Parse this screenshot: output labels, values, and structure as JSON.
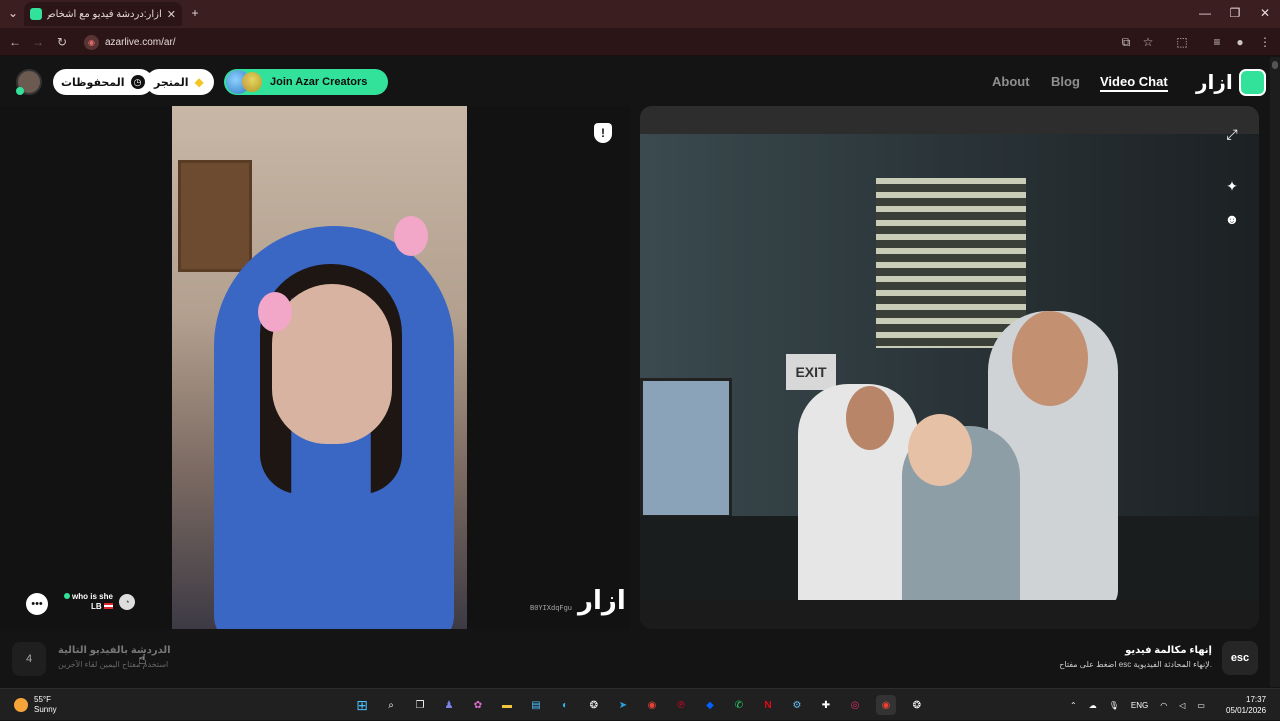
{
  "browser": {
    "tab_title": "آزار:دردشة فيديو مع أشخاص",
    "tab_close": "✕",
    "new_tab": "+",
    "url": "azarlive.com/ar/",
    "window_min": "—",
    "window_max": "❐",
    "window_close": "✕"
  },
  "header": {
    "saved_label": "المحفوظات",
    "store_label": "المتجر",
    "creators_label": "Join Azar Creators",
    "nav": {
      "about": "About",
      "blog": "Blog",
      "video_chat": "Video Chat"
    },
    "logo_text": "ازار"
  },
  "remote_video": {
    "peer_name": "who is she",
    "peer_country": "LB",
    "session_id": "B0YIXdqFgu",
    "watermark": "ازار"
  },
  "bottom": {
    "next_key": "4",
    "next_title": "الدردشة بالفيديو التالية",
    "next_subtitle": "استخدم مفتاح اليمين لقاء الآخرين",
    "end_key": "esc",
    "end_title": "إنهاء مكالمة فيديو",
    "end_subtitle": "اضغط على مفتاح esc لإنهاء المحادثة الفيديوية."
  },
  "taskbar": {
    "temperature": "55°F",
    "condition": "Sunny",
    "language": "ENG",
    "time": "17:37",
    "date": "05/01/2026"
  },
  "colors": {
    "accent": "#33e29a",
    "tabbar": "#3b1e1f",
    "page_bg": "#141414"
  }
}
